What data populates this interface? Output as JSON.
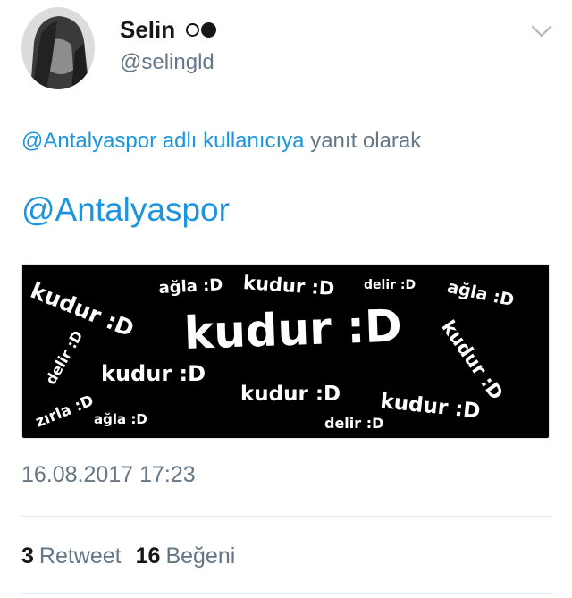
{
  "author": {
    "display_name": "Selin",
    "handle": "@selingld"
  },
  "reply": {
    "to_handle": "@Antalyaspor",
    "to_suffix": " adlı kullanıcıya",
    "trailing": " yanıt olarak"
  },
  "tweet": {
    "text": "@Antalyaspor"
  },
  "media": {
    "words": [
      {
        "id": "w1",
        "text": "kudur :D"
      },
      {
        "id": "w2",
        "text": "ağla :D"
      },
      {
        "id": "w3",
        "text": "kudur :D"
      },
      {
        "id": "w4",
        "text": "delir :D"
      },
      {
        "id": "w5",
        "text": "ağla :D"
      },
      {
        "id": "w6",
        "text": "kudur :D"
      },
      {
        "id": "w7",
        "text": "delir :D"
      },
      {
        "id": "w8",
        "text": "kudur :D"
      },
      {
        "id": "w9",
        "text": "kudur :D"
      },
      {
        "id": "w10",
        "text": "zırla :D"
      },
      {
        "id": "w11",
        "text": "ağla :D"
      },
      {
        "id": "w12",
        "text": "kudur :D"
      },
      {
        "id": "w13",
        "text": "kudur :D"
      },
      {
        "id": "w14",
        "text": "delir :D"
      }
    ]
  },
  "timestamp": "16.08.2017 17:23",
  "stats": {
    "retweets_count": "3",
    "retweets_label": "Retweet",
    "likes_count": "16",
    "likes_label": "Beğeni"
  },
  "colors": {
    "link": "#1b95e0",
    "secondary_text": "#657786",
    "primary_text": "#14171a",
    "divider": "#e1e8ed"
  },
  "icons": {
    "menu": "chevron-down-icon",
    "status": "circle-icons"
  }
}
